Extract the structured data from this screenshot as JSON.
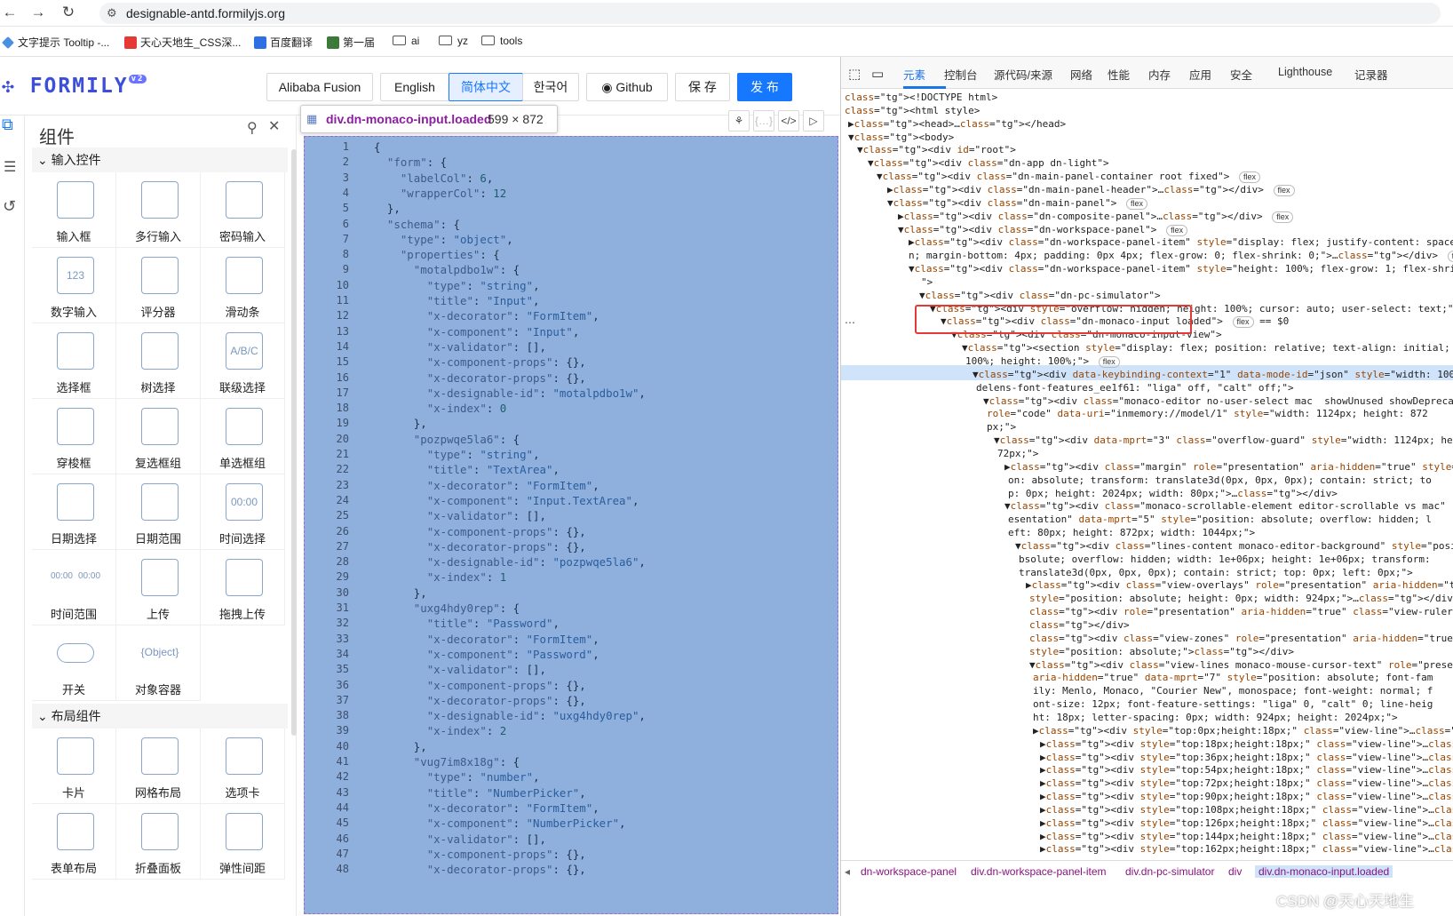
{
  "browser": {
    "url": "designable-antd.formilyjs.org",
    "bookmarks": [
      "文字提示 Tooltip -...",
      "天心天地生_CSS深...",
      "百度翻译",
      "第一届",
      "ai",
      "yz",
      "tools"
    ]
  },
  "app": {
    "logo": "FORMILY",
    "logo_badge": "v2",
    "header_buttons": [
      "Alibaba Fusion",
      "English",
      "简体中文",
      "한국어",
      "Github",
      "保 存",
      "发 布"
    ],
    "active_language": "简体中文"
  },
  "panel": {
    "title": "组件",
    "sections": [
      {
        "label": "输入控件",
        "items": [
          "输入框",
          "多行输入",
          "密码输入",
          "数字输入",
          "评分器",
          "滑动条",
          "选择框",
          "树选择",
          "联级选择",
          "穿梭框",
          "复选框组",
          "单选框组",
          "日期选择",
          "日期范围",
          "时间选择",
          "时间范围",
          "上传",
          "拖拽上传",
          "开关",
          "对象容器"
        ]
      },
      {
        "label": "布局组件",
        "items": [
          "卡片",
          "网格布局",
          "选项卡",
          "表单布局",
          "折叠面板",
          "弹性间距"
        ]
      }
    ],
    "icon_texts": {
      "number": "123",
      "time": "00:00",
      "range_a": "00:00",
      "range_b": "00:00",
      "object": "{Object}",
      "cascader": "A/B/C"
    }
  },
  "inspector_tip": {
    "name": "div.dn-monaco-input.loaded",
    "size": "599 × 872"
  },
  "code_lines": [
    "{",
    "  \"form\": {",
    "    \"labelCol\": 6,",
    "    \"wrapperCol\": 12",
    "  },",
    "  \"schema\": {",
    "    \"type\": \"object\",",
    "    \"properties\": {",
    "      \"motalpdbo1w\": {",
    "        \"type\": \"string\",",
    "        \"title\": \"Input\",",
    "        \"x-decorator\": \"FormItem\",",
    "        \"x-component\": \"Input\",",
    "        \"x-validator\": [],",
    "        \"x-component-props\": {},",
    "        \"x-decorator-props\": {},",
    "        \"x-designable-id\": \"motalpdbo1w\",",
    "        \"x-index\": 0",
    "      },",
    "      \"pozpwqe5la6\": {",
    "        \"type\": \"string\",",
    "        \"title\": \"TextArea\",",
    "        \"x-decorator\": \"FormItem\",",
    "        \"x-component\": \"Input.TextArea\",",
    "        \"x-validator\": [],",
    "        \"x-component-props\": {},",
    "        \"x-decorator-props\": {},",
    "        \"x-designable-id\": \"pozpwqe5la6\",",
    "        \"x-index\": 1",
    "      },",
    "      \"uxg4hdy0rep\": {",
    "        \"title\": \"Password\",",
    "        \"x-decorator\": \"FormItem\",",
    "        \"x-component\": \"Password\",",
    "        \"x-validator\": [],",
    "        \"x-component-props\": {},",
    "        \"x-decorator-props\": {},",
    "        \"x-designable-id\": \"uxg4hdy0rep\",",
    "        \"x-index\": 2",
    "      },",
    "      \"vug7im8x18g\": {",
    "        \"type\": \"number\",",
    "        \"title\": \"NumberPicker\",",
    "        \"x-decorator\": \"FormItem\",",
    "        \"x-component\": \"NumberPicker\",",
    "        \"x-validator\": [],",
    "        \"x-component-props\": {},",
    "        \"x-decorator-props\": {},"
  ],
  "devtools": {
    "tabs": [
      "元素",
      "控制台",
      "源代码/来源",
      "网络",
      "性能",
      "内存",
      "应用",
      "安全",
      "Lighthouse",
      "记录器"
    ],
    "active_tab": "元素",
    "dom_lines": [
      "<!DOCTYPE html>",
      "<html style>",
      "▶<head>…</head>",
      "▼<body>",
      "▼<div id=\"root\">",
      "▼<div class=\"dn-app dn-light\">",
      "▼<div class=\"dn-main-panel-container root fixed\"> flex",
      "▶<div class=\"dn-main-panel-header\">…</div> flex",
      "▼<div class=\"dn-main-panel\"> flex",
      "▶<div class=\"dn-composite-panel\">…</div> flex",
      "▼<div class=\"dn-workspace-panel\"> flex",
      "▶<div class=\"dn-workspace-panel-item\" style=\"display: flex; justify-content: space-betwee",
      "n; margin-bottom: 4px; padding: 0px 4px; flex-grow: 0; flex-shrink: 0;\">…</div> flex",
      "▼<div class=\"dn-workspace-panel-item\" style=\"height: 100%; flex-grow: 1; flex-shrink: 1;",
      "\">",
      "▼<div class=\"dn-pc-simulator\">",
      "▼<div style=\"overflow: hidden; height: 100%; cursor: auto; user-select: text;\">",
      "▼<div class=\"dn-monaco-input loaded\"> flex == $0",
      "▼<div class=\"dn-monaco-input-view\">",
      "▼<section style=\"display: flex; position: relative; text-align: initial; width:",
      "100%; height: 100%;\"> flex",
      "▼<div data-keybinding-context=\"1\" data-mode-id=\"json\" style=\"width: 100%; --co",
      "delens-font-features_ee1f61: \"liga\" off, \"calt\" off;\">",
      "▼<div class=\"monaco-editor no-user-select mac  showUnused showDeprecated vs\"",
      "role=\"code\" data-uri=\"inmemory://model/1\" style=\"width: 1124px; height: 872",
      "px;\">",
      "▼<div data-mprt=\"3\" class=\"overflow-guard\" style=\"width: 1124px; height: 8",
      "72px;\">",
      "▶<div class=\"margin\" role=\"presentation\" aria-hidden=\"true\" style=\"positi",
      "on: absolute; transform: translate3d(0px, 0px, 0px); contain: strict; to",
      "p: 0px; height: 2024px; width: 80px;\">…</div>",
      "▼<div class=\"monaco-scrollable-element editor-scrollable vs mac\" role=\"pr",
      "esentation\" data-mprt=\"5\" style=\"position: absolute; overflow: hidden; l",
      "eft: 80px; height: 872px; width: 1044px;\">",
      "▼<div class=\"lines-content monaco-editor-background\" style=\"position: a",
      "bsolute; overflow: hidden; width: 1e+06px; height: 1e+06px; transform:",
      "translate3d(0px, 0px, 0px); contain: strict; top: 0px; left: 0px;\">",
      "▶<div class=\"view-overlays\" role=\"presentation\" aria-hidden=\"true\"",
      "style=\"position: absolute; height: 0px; width: 924px;\">…</div>",
      "<div role=\"presentation\" aria-hidden=\"true\" class=\"view-rulers\">",
      "</div>",
      "<div class=\"view-zones\" role=\"presentation\" aria-hidden=\"true\"",
      "style=\"position: absolute;\"></div>",
      "▼<div class=\"view-lines monaco-mouse-cursor-text\" role=\"presentation\"",
      "aria-hidden=\"true\" data-mprt=\"7\" style=\"position: absolute; font-fam",
      "ily: Menlo, Monaco, \"Courier New\", monospace; font-weight: normal; f",
      "ont-size: 12px; font-feature-settings: \"liga\" 0, \"calt\" 0; line-heig",
      "ht: 18px; letter-spacing: 0px; width: 924px; height: 2024px;\">",
      "▶<div style=\"top:0px;height:18px;\" class=\"view-line\">…</div>",
      "▶<div style=\"top:18px;height:18px;\" class=\"view-line\">…</div>",
      "▶<div style=\"top:36px;height:18px;\" class=\"view-line\">…</div>",
      "▶<div style=\"top:54px;height:18px;\" class=\"view-line\">…</div>",
      "▶<div style=\"top:72px;height:18px;\" class=\"view-line\">…</div>",
      "▶<div style=\"top:90px;height:18px;\" class=\"view-line\">…</div>",
      "▶<div style=\"top:108px;height:18px;\" class=\"view-line\">…</div>",
      "▶<div style=\"top:126px;height:18px;\" class=\"view-line\">…</div>",
      "▶<div style=\"top:144px;height:18px;\" class=\"view-line\">…</div>",
      "▶<div style=\"top:162px;height:18px;\" class=\"view-line\">…</div>"
    ],
    "breadcrumbs": [
      "dn-workspace-panel",
      "div.dn-workspace-panel-item",
      "div.dn-pc-simulator",
      "div",
      "div.dn-monaco-input.loaded"
    ]
  },
  "watermark": "CSDN @天心天地生",
  "colors": {
    "accent": "#1677ff",
    "selection": "#8fb0dd",
    "highlight_box": "#e53935",
    "devtools_active": "#1a73e8"
  }
}
